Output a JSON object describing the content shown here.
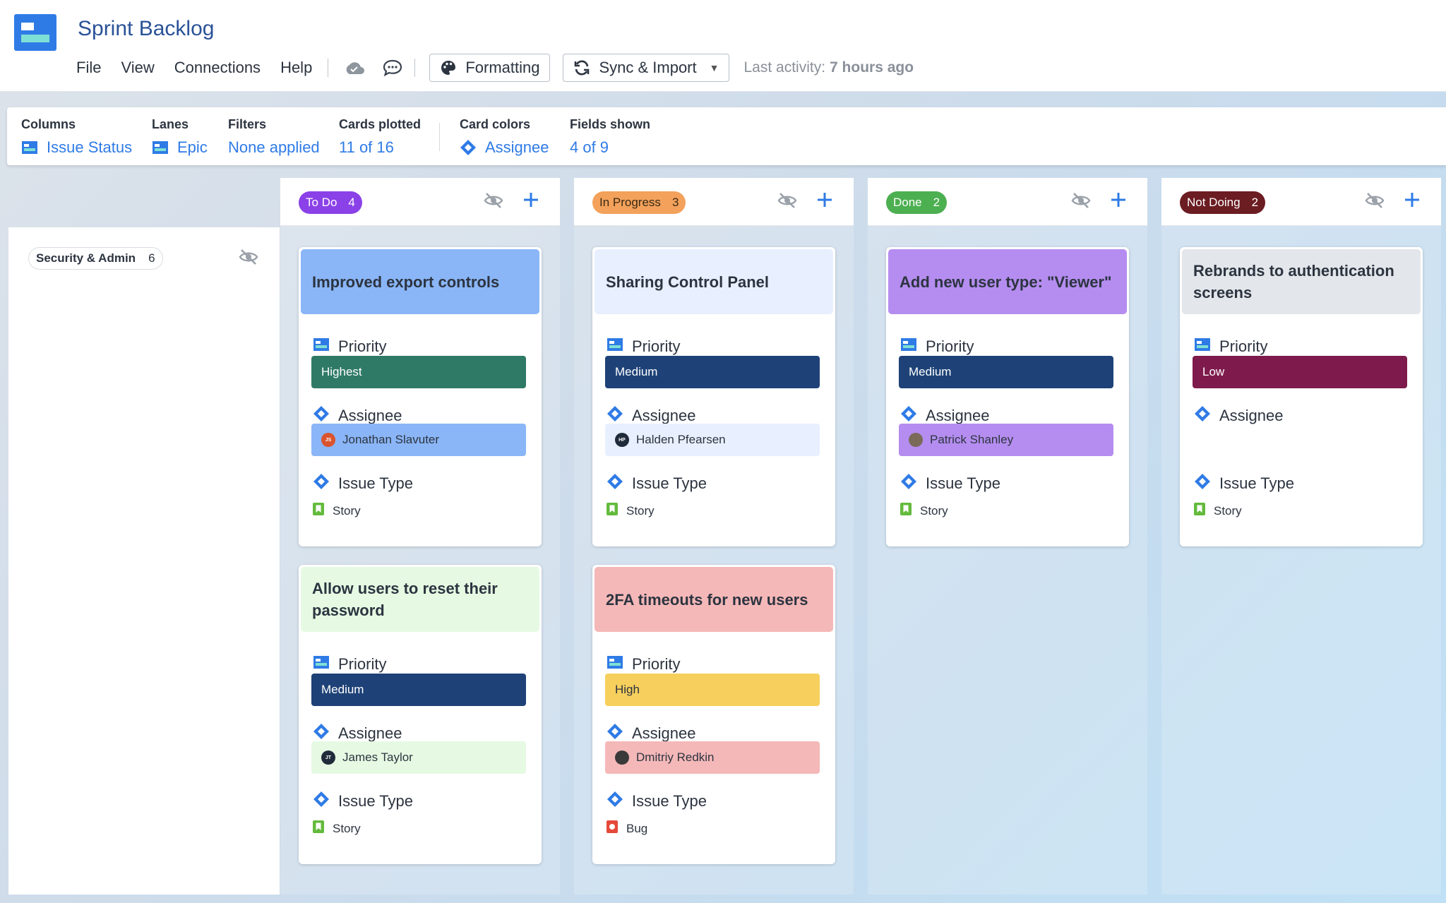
{
  "app": {
    "title": "Sprint Backlog",
    "menu": [
      "File",
      "View",
      "Connections",
      "Help"
    ],
    "formatting_label": "Formatting",
    "sync_label": "Sync & Import",
    "last_activity_label": "Last activity:",
    "last_activity_value": "7 hours ago"
  },
  "config": {
    "columns_label": "Columns",
    "columns_value": "Issue Status",
    "lanes_label": "Lanes",
    "lanes_value": "Epic",
    "filters_label": "Filters",
    "filters_value": "None applied",
    "plotted_label": "Cards plotted",
    "plotted_value": "11 of 16",
    "colors_label": "Card colors",
    "colors_value": "Assignee",
    "fields_label": "Fields shown",
    "fields_value": "4 of 9"
  },
  "lane": {
    "name": "Security & Admin",
    "count": "6"
  },
  "field_labels": {
    "priority": "Priority",
    "assignee": "Assignee",
    "issue_type": "Issue Type"
  },
  "colors": {
    "accent": "#2f7be6",
    "priority_highest": "#2f7a66",
    "priority_medium": "#1e4277",
    "priority_high": "#f6cf5c",
    "priority_low": "#7e1b4c"
  },
  "columns": [
    {
      "status": "To Do",
      "count": "4",
      "pill_bg": "#8b41e8",
      "pill_fg": "#ffffff",
      "cards": [
        {
          "title": "Improved export controls",
          "head_bg": "#8ab6f7",
          "priority": "Highest",
          "priority_bg": "#2f7a66",
          "priority_fg": "#ffffff",
          "assignee": "Jonathan Slavuter",
          "assignee_bg": "#8ab6f7",
          "avatar_bg": "#d9532d",
          "avatar_text": "JS",
          "issue_type": "Story",
          "type_icon": "story-icon"
        },
        {
          "title": "Allow users to reset their password",
          "head_bg": "#e6fae3",
          "priority": "Medium",
          "priority_bg": "#1e4277",
          "priority_fg": "#ffffff",
          "assignee": "James Taylor",
          "assignee_bg": "#e6fae3",
          "avatar_bg": "#1f2a3a",
          "avatar_text": "JT",
          "issue_type": "Story",
          "type_icon": "story-icon"
        }
      ]
    },
    {
      "status": "In Progress",
      "count": "3",
      "pill_bg": "#f3a15b",
      "pill_fg": "#3a2a14",
      "cards": [
        {
          "title": "Sharing Control Panel",
          "head_bg": "#e8efff",
          "priority": "Medium",
          "priority_bg": "#1e4277",
          "priority_fg": "#ffffff",
          "assignee": "Halden Pfearsen",
          "assignee_bg": "#e8efff",
          "avatar_bg": "#1f2a3a",
          "avatar_text": "HP",
          "issue_type": "Story",
          "type_icon": "story-icon"
        },
        {
          "title": "2FA timeouts for new users",
          "head_bg": "#f5b8b8",
          "priority": "High",
          "priority_bg": "#f6cf5c",
          "priority_fg": "#2c3440",
          "assignee": "Dmitriy Redkin",
          "assignee_bg": "#f5b8b8",
          "avatar_bg": "#3a3a3a",
          "avatar_text": "",
          "issue_type": "Bug",
          "type_icon": "bug-icon"
        }
      ]
    },
    {
      "status": "Done",
      "count": "2",
      "pill_bg": "#4caf50",
      "pill_fg": "#ffffff",
      "cards": [
        {
          "title": "Add new user type: \"Viewer\"",
          "head_bg": "#b58df0",
          "priority": "Medium",
          "priority_bg": "#1e4277",
          "priority_fg": "#ffffff",
          "assignee": "Patrick Shanley",
          "assignee_bg": "#b58df0",
          "avatar_bg": "#7a6a5a",
          "avatar_text": "",
          "issue_type": "Story",
          "type_icon": "story-icon"
        }
      ]
    },
    {
      "status": "Not Doing",
      "count": "2",
      "pill_bg": "#6b1d22",
      "pill_fg": "#ffffff",
      "cards": [
        {
          "title": "Rebrands to authentication screens",
          "head_bg": "#e3e6ea",
          "priority": "Low",
          "priority_bg": "#7e1b4c",
          "priority_fg": "#ffffff",
          "assignee": "",
          "assignee_bg": "",
          "avatar_bg": "",
          "avatar_text": "",
          "issue_type": "Story",
          "type_icon": "story-icon"
        }
      ]
    }
  ]
}
